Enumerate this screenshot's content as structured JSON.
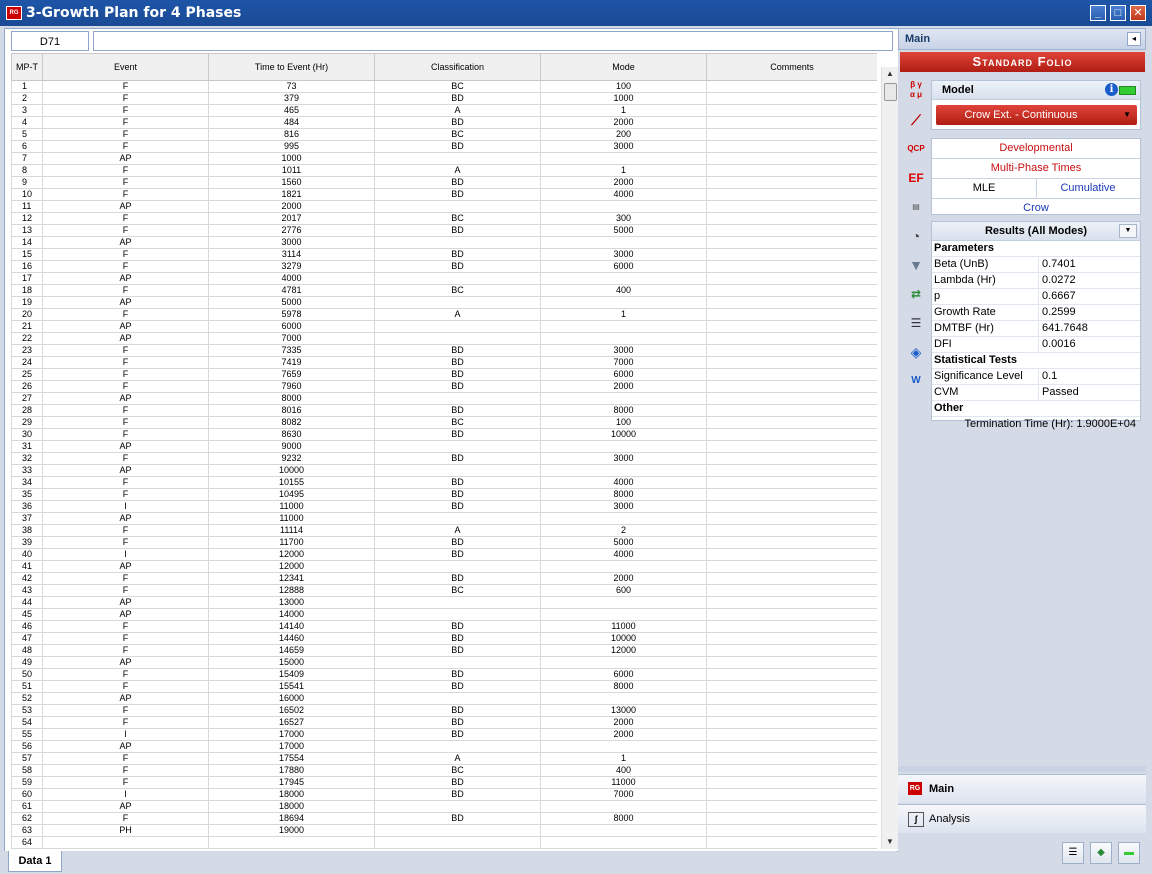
{
  "window": {
    "title": "3-Growth Plan for 4 Phases",
    "app_icon": "RG"
  },
  "cell_bar": {
    "cell_ref": "D71",
    "formula": ""
  },
  "grid": {
    "headers": [
      "MP-T",
      "Event",
      "Time to Event (Hr)",
      "Classification",
      "Mode",
      "Comments"
    ],
    "rows": [
      [
        "1",
        "F",
        "73",
        "BC",
        "100",
        ""
      ],
      [
        "2",
        "F",
        "379",
        "BD",
        "1000",
        ""
      ],
      [
        "3",
        "F",
        "465",
        "A",
        "1",
        ""
      ],
      [
        "4",
        "F",
        "484",
        "BD",
        "2000",
        ""
      ],
      [
        "5",
        "F",
        "816",
        "BC",
        "200",
        ""
      ],
      [
        "6",
        "F",
        "995",
        "BD",
        "3000",
        ""
      ],
      [
        "7",
        "AP",
        "1000",
        "",
        "",
        ""
      ],
      [
        "8",
        "F",
        "1011",
        "A",
        "1",
        ""
      ],
      [
        "9",
        "F",
        "1560",
        "BD",
        "2000",
        ""
      ],
      [
        "10",
        "F",
        "1821",
        "BD",
        "4000",
        ""
      ],
      [
        "11",
        "AP",
        "2000",
        "",
        "",
        ""
      ],
      [
        "12",
        "F",
        "2017",
        "BC",
        "300",
        ""
      ],
      [
        "13",
        "F",
        "2776",
        "BD",
        "5000",
        ""
      ],
      [
        "14",
        "AP",
        "3000",
        "",
        "",
        ""
      ],
      [
        "15",
        "F",
        "3114",
        "BD",
        "3000",
        ""
      ],
      [
        "16",
        "F",
        "3279",
        "BD",
        "6000",
        ""
      ],
      [
        "17",
        "AP",
        "4000",
        "",
        "",
        ""
      ],
      [
        "18",
        "F",
        "4781",
        "BC",
        "400",
        ""
      ],
      [
        "19",
        "AP",
        "5000",
        "",
        "",
        ""
      ],
      [
        "20",
        "F",
        "5978",
        "A",
        "1",
        ""
      ],
      [
        "21",
        "AP",
        "6000",
        "",
        "",
        ""
      ],
      [
        "22",
        "AP",
        "7000",
        "",
        "",
        ""
      ],
      [
        "23",
        "F",
        "7335",
        "BD",
        "3000",
        ""
      ],
      [
        "24",
        "F",
        "7419",
        "BD",
        "7000",
        ""
      ],
      [
        "25",
        "F",
        "7659",
        "BD",
        "6000",
        ""
      ],
      [
        "26",
        "F",
        "7960",
        "BD",
        "2000",
        ""
      ],
      [
        "27",
        "AP",
        "8000",
        "",
        "",
        ""
      ],
      [
        "28",
        "F",
        "8016",
        "BD",
        "8000",
        ""
      ],
      [
        "29",
        "F",
        "8082",
        "BC",
        "100",
        ""
      ],
      [
        "30",
        "F",
        "8630",
        "BD",
        "10000",
        ""
      ],
      [
        "31",
        "AP",
        "9000",
        "",
        "",
        ""
      ],
      [
        "32",
        "F",
        "9232",
        "BD",
        "3000",
        ""
      ],
      [
        "33",
        "AP",
        "10000",
        "",
        "",
        ""
      ],
      [
        "34",
        "F",
        "10155",
        "BD",
        "4000",
        ""
      ],
      [
        "35",
        "F",
        "10495",
        "BD",
        "8000",
        ""
      ],
      [
        "36",
        "I",
        "11000",
        "BD",
        "3000",
        ""
      ],
      [
        "37",
        "AP",
        "11000",
        "",
        "",
        ""
      ],
      [
        "38",
        "F",
        "11114",
        "A",
        "2",
        ""
      ],
      [
        "39",
        "F",
        "11700",
        "BD",
        "5000",
        ""
      ],
      [
        "40",
        "I",
        "12000",
        "BD",
        "4000",
        ""
      ],
      [
        "41",
        "AP",
        "12000",
        "",
        "",
        ""
      ],
      [
        "42",
        "F",
        "12341",
        "BD",
        "2000",
        ""
      ],
      [
        "43",
        "F",
        "12888",
        "BC",
        "600",
        ""
      ],
      [
        "44",
        "AP",
        "13000",
        "",
        "",
        ""
      ],
      [
        "45",
        "AP",
        "14000",
        "",
        "",
        ""
      ],
      [
        "46",
        "F",
        "14140",
        "BD",
        "11000",
        ""
      ],
      [
        "47",
        "F",
        "14460",
        "BD",
        "10000",
        ""
      ],
      [
        "48",
        "F",
        "14659",
        "BD",
        "12000",
        ""
      ],
      [
        "49",
        "AP",
        "15000",
        "",
        "",
        ""
      ],
      [
        "50",
        "F",
        "15409",
        "BD",
        "6000",
        ""
      ],
      [
        "51",
        "F",
        "15541",
        "BD",
        "8000",
        ""
      ],
      [
        "52",
        "AP",
        "16000",
        "",
        "",
        ""
      ],
      [
        "53",
        "F",
        "16502",
        "BD",
        "13000",
        ""
      ],
      [
        "54",
        "F",
        "16527",
        "BD",
        "2000",
        ""
      ],
      [
        "55",
        "I",
        "17000",
        "BD",
        "2000",
        ""
      ],
      [
        "56",
        "AP",
        "17000",
        "",
        "",
        ""
      ],
      [
        "57",
        "F",
        "17554",
        "A",
        "1",
        ""
      ],
      [
        "58",
        "F",
        "17880",
        "BC",
        "400",
        ""
      ],
      [
        "59",
        "F",
        "17945",
        "BD",
        "11000",
        ""
      ],
      [
        "60",
        "I",
        "18000",
        "BD",
        "7000",
        ""
      ],
      [
        "61",
        "AP",
        "18000",
        "",
        "",
        ""
      ],
      [
        "62",
        "F",
        "18694",
        "BD",
        "8000",
        ""
      ],
      [
        "63",
        "PH",
        "19000",
        "",
        "",
        ""
      ],
      [
        "64",
        "",
        "",
        "",
        "",
        ""
      ],
      [
        "",
        "",
        "",
        "",
        "",
        ""
      ]
    ]
  },
  "sheet_tab": "Data 1",
  "side": {
    "header": "Main",
    "folio_title": "Standard Folio",
    "model_label": "Model",
    "model_value": "Crow Ext. - Continuous",
    "options": {
      "developmental": "Developmental",
      "multi_phase": "Multi-Phase Times",
      "mle": "MLE",
      "cumulative": "Cumulative",
      "crow": "Crow"
    },
    "results_title": "Results (All Modes)",
    "parameters_label": "Parameters",
    "parameters": [
      {
        "name": "Beta (UnB)",
        "value": "0.7401"
      },
      {
        "name": "Lambda (Hr)",
        "value": "0.0272"
      },
      {
        "name": "p",
        "value": "0.6667"
      },
      {
        "name": "Growth Rate",
        "value": "0.2599"
      },
      {
        "name": "DMTBF (Hr)",
        "value": "641.7648"
      },
      {
        "name": "DFI",
        "value": "0.0016"
      }
    ],
    "stat_label": "Statistical Tests",
    "stats": [
      {
        "name": "Significance Level",
        "value": "0.1"
      },
      {
        "name": "CVM",
        "value": "Passed"
      }
    ],
    "other_label": "Other",
    "termination": "Termination Time (Hr): 1.9000E+04",
    "nav_main": "Main",
    "nav_analysis": "Analysis"
  }
}
